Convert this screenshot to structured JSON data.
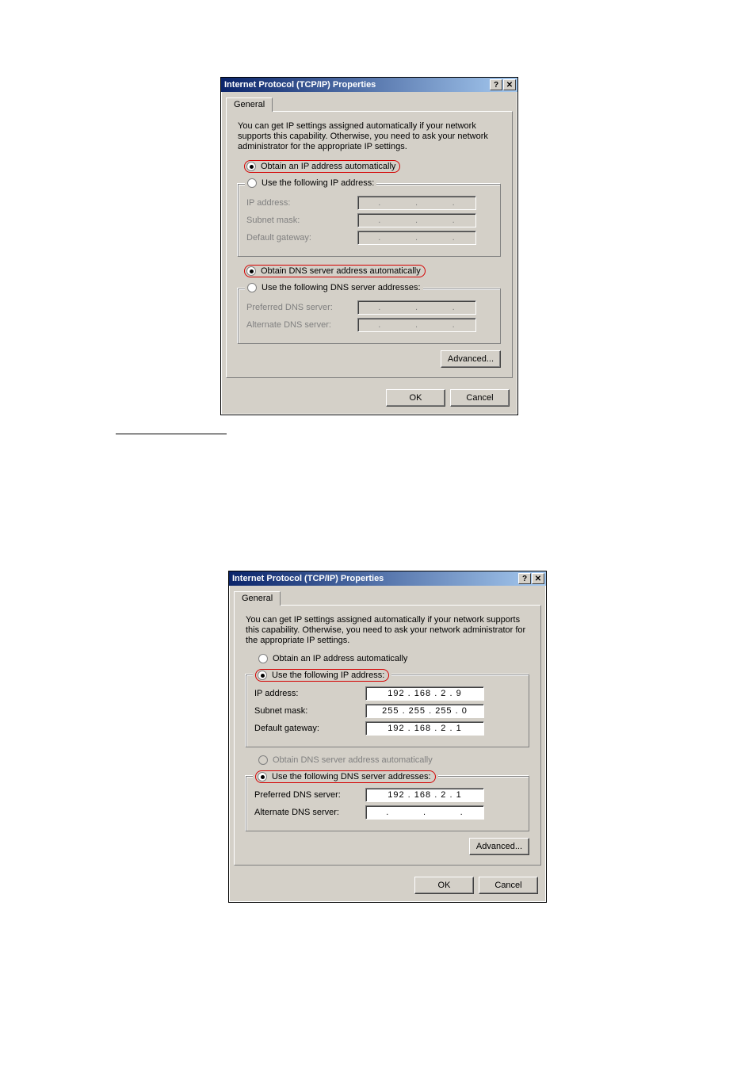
{
  "dialog1": {
    "title": "Internet Protocol (TCP/IP) Properties",
    "tab": "General",
    "explain": "You can get IP settings assigned automatically if your network supports this capability. Otherwise, you need to ask your network administrator for the appropriate IP settings.",
    "radio_auto_ip": "Obtain an IP address automatically",
    "radio_manual_ip": "Use the following IP address:",
    "ip_label": "IP address:",
    "subnet_label": "Subnet mask:",
    "gateway_label": "Default gateway:",
    "radio_auto_dns": "Obtain DNS server address automatically",
    "radio_manual_dns": "Use the following DNS server addresses:",
    "pref_dns_label": "Preferred DNS server:",
    "alt_dns_label": "Alternate DNS server:",
    "advanced": "Advanced...",
    "ok": "OK",
    "cancel": "Cancel"
  },
  "dialog2": {
    "title": "Internet Protocol (TCP/IP) Properties",
    "tab": "General",
    "explain": "You can get IP settings assigned automatically if your network supports this capability. Otherwise, you need to ask your network administrator for the appropriate IP settings.",
    "radio_auto_ip": "Obtain an IP address automatically",
    "radio_manual_ip": "Use the following IP address:",
    "ip_label": "IP address:",
    "ip_value": "192 . 168 .  2  .  9",
    "subnet_label": "Subnet mask:",
    "subnet_value": "255 . 255 . 255 .  0",
    "gateway_label": "Default gateway:",
    "gateway_value": "192 . 168 .  2  .  1",
    "radio_auto_dns": "Obtain DNS server address automatically",
    "radio_manual_dns": "Use the following DNS server addresses:",
    "pref_dns_label": "Preferred DNS server:",
    "pref_dns_value": "192 . 168 .  2  .  1",
    "alt_dns_label": "Alternate DNS server:",
    "alt_dns_value": " .       .       . ",
    "advanced": "Advanced...",
    "ok": "OK",
    "cancel": "Cancel"
  }
}
